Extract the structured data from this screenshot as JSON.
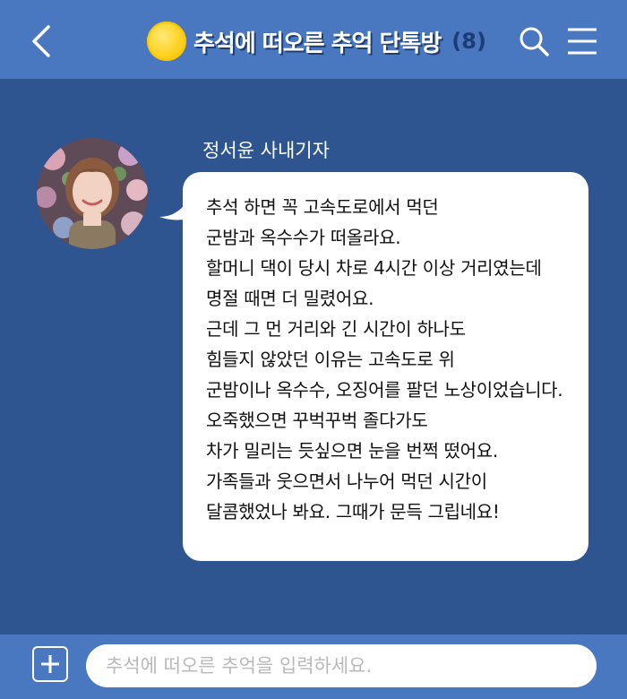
{
  "header": {
    "back_icon": "chevron-left-icon",
    "emblem_icon": "full-moon-icon",
    "title": "추석에 떠오른 추억 단톡방",
    "member_count": "(8)",
    "search_icon": "search-icon",
    "menu_icon": "hamburger-menu-icon"
  },
  "message": {
    "sender": "정서윤 사내기자",
    "lines": [
      "추석 하면 꼭 고속도로에서 먹던",
      "군밤과 옥수수가 떠올라요.",
      "할머니 댁이 당시 차로 4시간 이상 거리였는데",
      "명절 때면 더 밀렸어요.",
      "근데 그 먼 거리와 긴 시간이 하나도",
      "힘들지 않았던 이유는 고속도로 위",
      "군밤이나 옥수수, 오징어를 팔던 노상이었습니다.",
      "오죽했으면 꾸벅꾸벅 졸다가도",
      "차가 밀리는 듯싶으면 눈을 번쩍 떴어요.",
      "가족들과 웃으면서 나누어 먹던 시간이",
      "달콤했었나 봐요. 그때가 문득 그립네요!"
    ]
  },
  "composer": {
    "add_icon": "plus-icon",
    "placeholder": "추석에 떠오른 추억을 입력하세요."
  },
  "colors": {
    "header_bg": "#4a78c0",
    "chat_bg": "#2f5590",
    "bubble_bg": "#ffffff",
    "moon": "#ffd21f"
  }
}
